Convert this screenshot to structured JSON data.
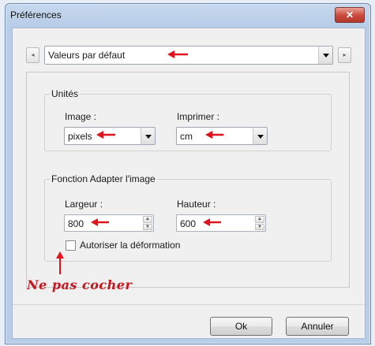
{
  "window": {
    "title": "Préférences",
    "close_glyph": "✕"
  },
  "preset": {
    "value": "Valeurs par défaut",
    "prev_glyph": "◂",
    "next_glyph": "▸"
  },
  "units": {
    "legend": "Unités",
    "image_label": "Image :",
    "image_value": "pixels",
    "print_label": "Imprimer :",
    "print_value": "cm"
  },
  "fit": {
    "legend": "Fonction Adapter l'image",
    "width_label": "Largeur :",
    "width_value": "800",
    "height_label": "Hauteur :",
    "height_value": "600",
    "allow_distortion_label": "Autoriser la déformation",
    "allow_distortion_checked": false
  },
  "annotation": {
    "handwritten_note": "Ne pas cocher",
    "arrow_color": "#e0141c"
  },
  "buttons": {
    "ok": "Ok",
    "cancel": "Annuler"
  },
  "icons": {
    "spin_up": "▲",
    "spin_down": "▼"
  }
}
